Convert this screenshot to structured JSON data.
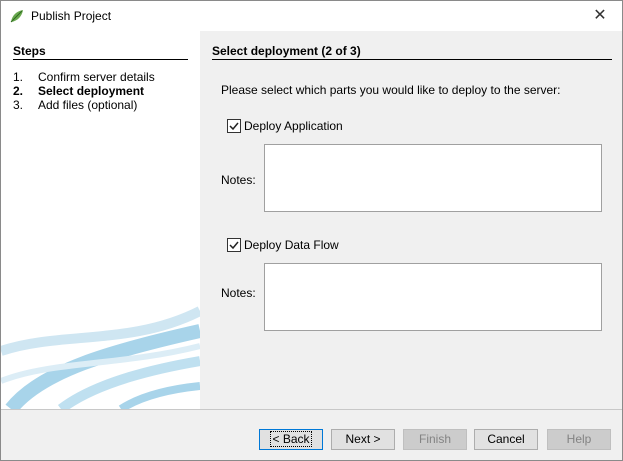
{
  "window": {
    "title": "Publish Project",
    "app_icon": "leaf-icon",
    "close_icon": "close-icon"
  },
  "steps_panel": {
    "heading": "Steps",
    "items": [
      {
        "num": "1.",
        "label": "Confirm server details",
        "current": false
      },
      {
        "num": "2.",
        "label": "Select deployment",
        "current": true
      },
      {
        "num": "3.",
        "label": "Add files (optional)",
        "current": false
      }
    ]
  },
  "main": {
    "heading": "Select deployment (2 of 3)",
    "instruction": "Please select which parts you would like to deploy to the server:",
    "deploy_application": {
      "label": "Deploy Application",
      "checked": true,
      "notes_label": "Notes:",
      "notes_value": ""
    },
    "deploy_data_flow": {
      "label": "Deploy Data Flow",
      "checked": true,
      "notes_label": "Notes:",
      "notes_value": ""
    }
  },
  "buttons": {
    "back": "< Back",
    "next": "Next >",
    "finish": "Finish",
    "cancel": "Cancel",
    "help": "Help"
  },
  "colors": {
    "accent": "#0078d7",
    "swoosh": "#a8d4ea",
    "panel_bg": "#f0f0f0"
  }
}
